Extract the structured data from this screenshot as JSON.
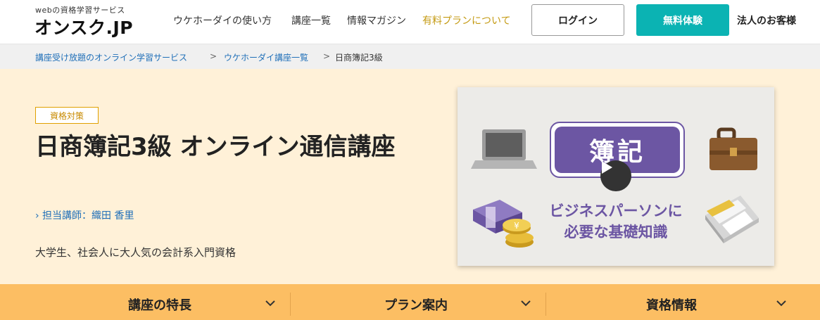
{
  "header": {
    "logo_sub": "webの資格学習サービス",
    "logo_main": "オンスク.JP",
    "nav": [
      {
        "label": "ウケホーダイの使い方"
      },
      {
        "label": "講座一覧"
      },
      {
        "label": "情報マガジン"
      },
      {
        "label": "有料プランについて"
      }
    ],
    "login_label": "ログイン",
    "trial_label": "無料体験",
    "corporate_label": "法人のお客様"
  },
  "breadcrumb": [
    {
      "label": "講座受け放題のオンライン学習サービス"
    },
    {
      "label": "ウケホーダイ講座一覧"
    },
    {
      "label": "日商簿記3級"
    }
  ],
  "breadcrumb_separator": ">",
  "hero": {
    "badge": "資格対策",
    "title": "日商簿記3級 オンライン通信講座",
    "lecturer": "› 担当講師：織田 香里",
    "lead": "大学生、社会人に大人気の会計系入門資格"
  },
  "video": {
    "banner_text": "簿記",
    "caption_line1": "ビジネスパーソンに",
    "caption_line2": "必要な基礎知識",
    "icons": [
      "laptop-icon",
      "briefcase-icon",
      "money-stack-icon",
      "calculator-icon",
      "play-icon"
    ]
  },
  "tabs": [
    {
      "label": "講座の特長"
    },
    {
      "label": "プラン案内"
    },
    {
      "label": "資格情報"
    }
  ],
  "colors": {
    "accent_teal": "#0bb3b3",
    "hero_bg": "#fff1d8",
    "tab_bg": "#fcbe63",
    "link_blue": "#1f6fb8",
    "gold": "#c49a12",
    "boki_purple": "#6c56a3"
  }
}
